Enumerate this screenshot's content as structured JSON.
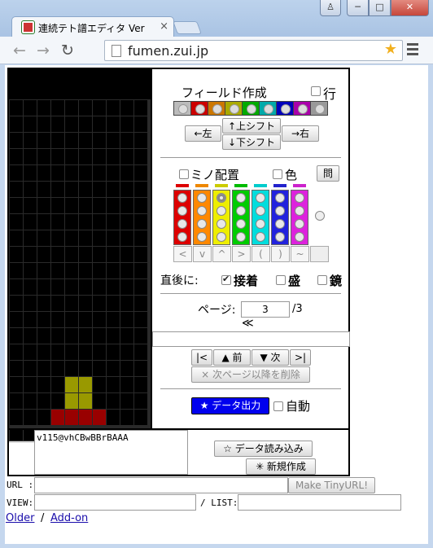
{
  "browser": {
    "tab_title": "連続テト譜エディタ Ver",
    "tab_close": "×",
    "url": "fumen.zui.jp"
  },
  "colors": {
    "field_palette": [
      "#bbbbbb",
      "#cc0000",
      "#cc7700",
      "#aaaa00",
      "#00aa00",
      "#00aaaa",
      "#0000bb",
      "#aa00aa",
      "#999999"
    ],
    "mino_colors": [
      "#dd0000",
      "#ff8800",
      "#eeee00",
      "#00cc00",
      "#00dddd",
      "#2222dd",
      "#dd22dd"
    ],
    "mino_tab_colors": [
      "#dd0000",
      "#ee8800",
      "#cccc00",
      "#00bb00",
      "#00cccc",
      "#2222cc",
      "#cc22cc"
    ],
    "board_yellow": "#999900",
    "board_red": "#990000",
    "output_button_bg": "#0000ee"
  },
  "panel": {
    "field_title": "フィールド作成",
    "row_label": "行",
    "shift_left": "←左",
    "shift_up": "↑上シフト",
    "shift_down": "↓下シフト",
    "shift_right": "→右",
    "mino_title": "ミノ配置",
    "color_label": "色",
    "question_button": "問",
    "rotations": [
      "<",
      "v",
      "^",
      ">",
      "(",
      ")",
      "~"
    ],
    "after_label": "直後に:",
    "lock_label": "接着",
    "raise_label": "盛",
    "mirror_label": "鏡",
    "page_label": "ページ:",
    "page_value": "3",
    "page_total": "/3",
    "skip_back": "≪",
    "first": "|<",
    "prev": "▲ 前",
    "next": "▼ 次",
    "last": ">|",
    "delete_after": "× 次ページ以降を削除",
    "output_button": "★ データ出力",
    "auto_label": "自動"
  },
  "data": {
    "code": "v115@vhCBwBBrBAAA",
    "load_button": "☆ データ読み込み",
    "new_button": "✳ 新規作成"
  },
  "footer": {
    "url_label": "URL :",
    "tinyurl_button": "Make TinyURL!",
    "view_label": "VIEW:",
    "list_label": "/ LIST:",
    "older_link": "Older",
    "sep": "/",
    "addon_link": "Add-on"
  }
}
